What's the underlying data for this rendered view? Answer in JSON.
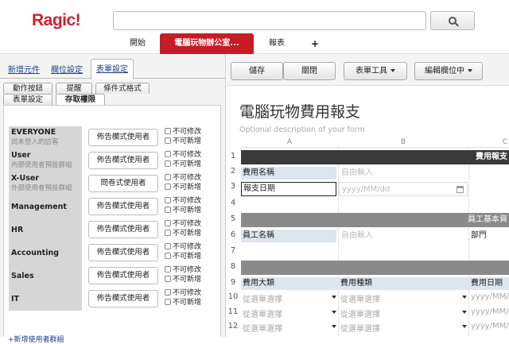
{
  "app": {
    "logo": "Ragic!",
    "nav": [
      "開始",
      "電腦玩物辦公室...",
      "報表",
      "+"
    ]
  },
  "left": {
    "tabs": [
      "新增元件",
      "欄位設定",
      "表單設定"
    ],
    "subtabs_row1": [
      "動作按鈕",
      "提醒",
      "條件式格式"
    ],
    "subtabs_row2": [
      "表單設定",
      "存取權限"
    ],
    "rows": [
      {
        "name": "EVERYONE",
        "desc": "尚未登入的訪客",
        "access": "佈告欄式使用者"
      },
      {
        "name": "User",
        "desc": "內部使用者預設群組",
        "access": "佈告欄式使用者"
      },
      {
        "name": "X-User",
        "desc": "外部使用者預設群組",
        "access": "問卷式使用者"
      },
      {
        "name": "Management",
        "desc": "",
        "access": "佈告欄式使用者"
      },
      {
        "name": "HR",
        "desc": "",
        "access": "佈告欄式使用者"
      },
      {
        "name": "Accounting",
        "desc": "",
        "access": "佈告欄式使用者"
      },
      {
        "name": "Sales",
        "desc": "",
        "access": "佈告欄式使用者"
      },
      {
        "name": "IT",
        "desc": "",
        "access": "佈告欄式使用者"
      }
    ],
    "no_modify": "不可修改",
    "no_add": "不可新增",
    "bottom_link": "+新增使用者群組"
  },
  "right": {
    "toolbar": {
      "save": "儲存",
      "close": "關閉",
      "form_tools": "表單工具",
      "edit_fields": "編輯欄位中"
    },
    "title": "電腦玩物費用報支",
    "description": "Optional description of your form",
    "columns": [
      "A",
      "B",
      "C"
    ],
    "row_numbers": [
      "1",
      "2",
      "3",
      "4",
      "5",
      "6",
      "7",
      "8",
      "9",
      "10",
      "11",
      "12"
    ],
    "band1": "費用報支",
    "band2": "員工基本資",
    "field_fee_name": "費用名稱",
    "free_input": "自由輸入",
    "field_report_date": "報支日期",
    "date_placeholder": "yyyy/MM/dd",
    "field_employee_name": "員工名稱",
    "field_department": "部門",
    "hdr_category": "費用大類",
    "hdr_type": "費用種類",
    "hdr_date": "費用日期",
    "select_placeholder": "從選單選擇",
    "date_short": "yyyy/MM/"
  }
}
